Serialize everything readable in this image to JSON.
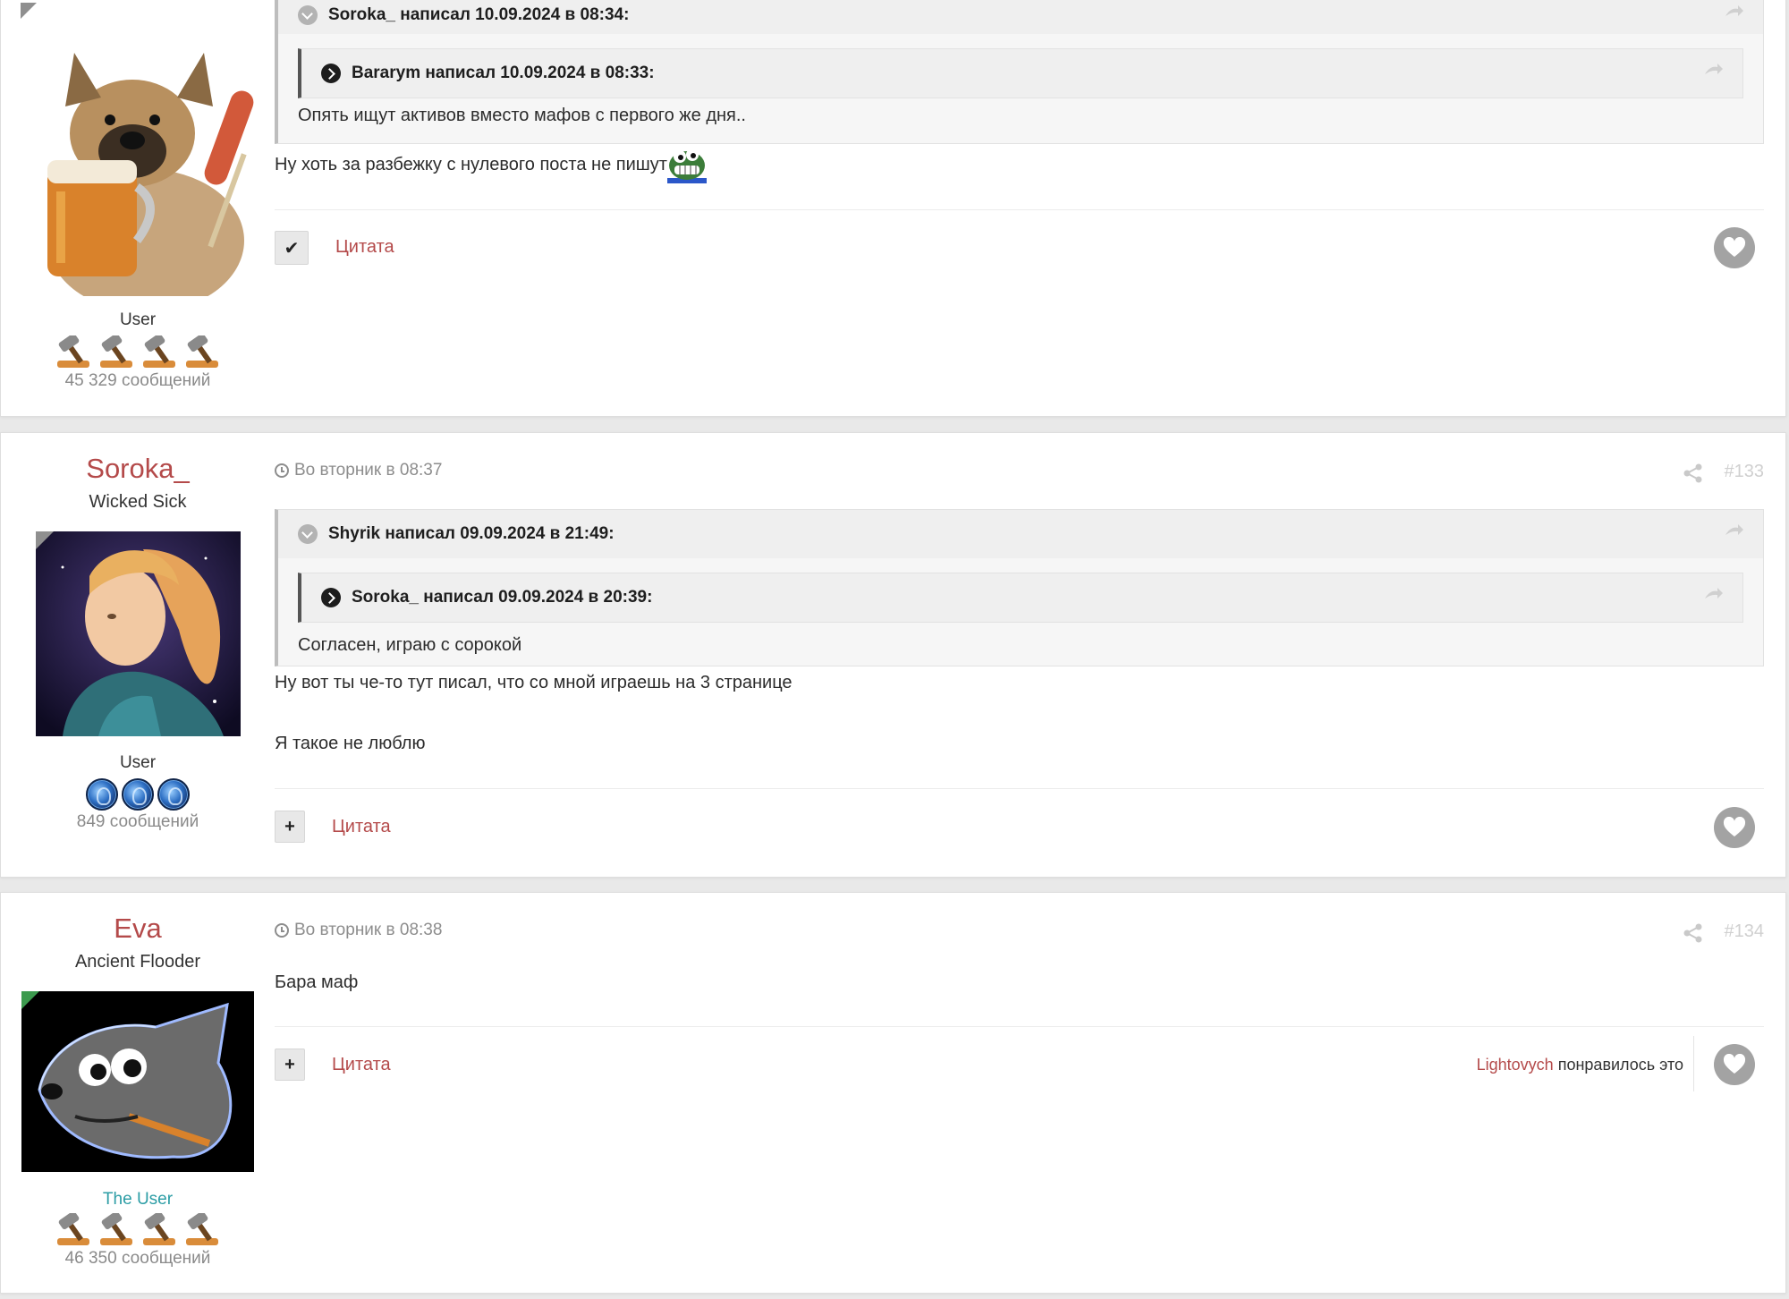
{
  "posts": [
    {
      "author_rank": "User",
      "author_posts": "45 329 сообщений",
      "quote_outer_header": "Soroka_ написал 10.09.2024 в 08:34:",
      "quote_inner_header": "Bararym написал 10.09.2024 в 08:33:",
      "quote_inner_text": "Опять ищут активов вместо мафов с первого же дня..",
      "text_lines": [
        "Ну хоть за разбежку с нулевого поста не пишут"
      ],
      "quote_label": "Цитата",
      "select_icon": "check-icon",
      "rank_icon": "hammer-icon",
      "rank_pips": 4
    },
    {
      "author_name": "Soroka_",
      "author_title": "Wicked Sick",
      "author_rank": "User",
      "author_posts": "849 сообщений",
      "timestamp": "Во вторник в 08:37",
      "post_number": "#133",
      "quote_outer_header": "Shyrik написал 09.09.2024 в 21:49:",
      "quote_inner_header": "Soroka_ написал 09.09.2024 в 20:39:",
      "quote_outer_text": "Согласен, играю с сорокой",
      "text_lines": [
        "Ну вот ты че-то тут писал, что со мной играешь на 3 странице",
        "Я такое не люблю"
      ],
      "quote_label": "Цитата",
      "select_icon": "plus-icon",
      "rank_icon": "orb-icon",
      "rank_pips": 3
    },
    {
      "author_name": "Eva",
      "author_title": "Ancient Flooder",
      "author_rank": "The User",
      "author_posts": "46 350 сообщений",
      "timestamp": "Во вторник в 08:38",
      "post_number": "#134",
      "text_lines": [
        "Бара маф"
      ],
      "quote_label": "Цитата",
      "select_icon": "plus-icon",
      "liked_by_user": "Lightovych",
      "liked_by_suffix": "понравилось это",
      "rank_icon": "hammer-icon",
      "rank_pips": 4
    }
  ],
  "colors": {
    "username": "#b44a4a",
    "special_rank": "#2c9da5",
    "link": "#b44a4a",
    "muted": "#8d8d8d"
  }
}
